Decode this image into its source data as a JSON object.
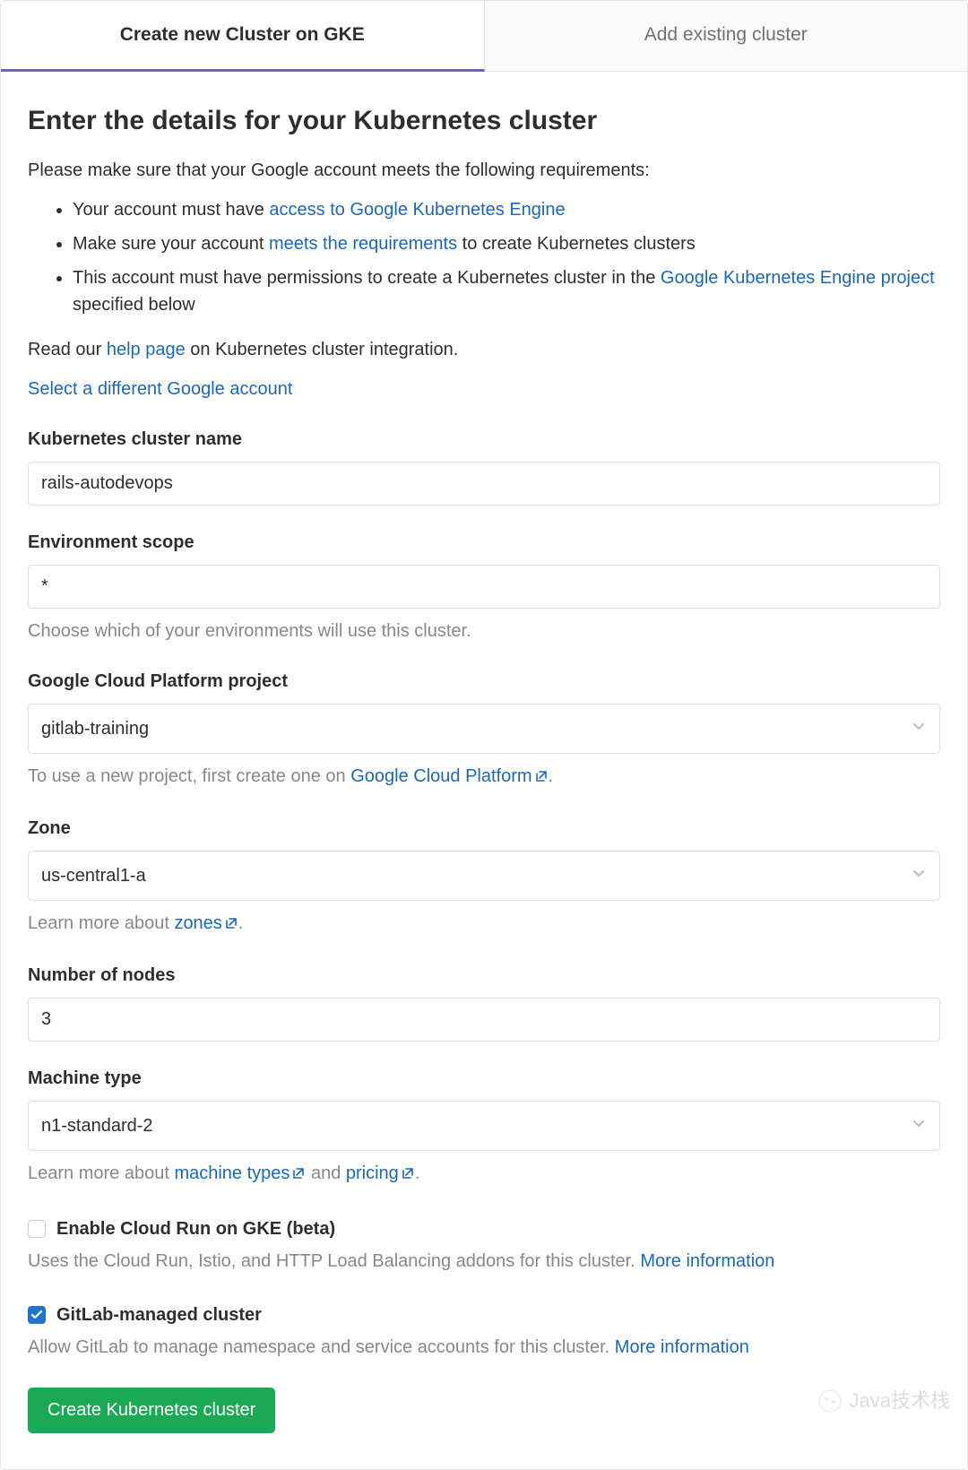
{
  "tabs": {
    "create": "Create new Cluster on GKE",
    "add": "Add existing cluster"
  },
  "heading": "Enter the details for your Kubernetes cluster",
  "intro": "Please make sure that your Google account meets the following requirements:",
  "req1_a": "Your account must have ",
  "req1_link": "access to Google Kubernetes Engine",
  "req2_a": "Make sure your account ",
  "req2_link": "meets the requirements",
  "req2_b": " to create Kubernetes clusters",
  "req3_a": "This account must have permissions to create a Kubernetes cluster in the ",
  "req3_link": "Google Kubernetes Engine project",
  "req3_b": " specified below",
  "readour_a": "Read our ",
  "readour_link": "help page",
  "readour_b": " on Kubernetes cluster integration.",
  "select_account": "Select a different Google account",
  "fields": {
    "name": {
      "label": "Kubernetes cluster name",
      "value": "rails-autodevops"
    },
    "env": {
      "label": "Environment scope",
      "value": "*",
      "help": "Choose which of your environments will use this cluster."
    },
    "project": {
      "label": "Google Cloud Platform project",
      "value": "gitlab-training",
      "help_a": "To use a new project, first create one on ",
      "help_link": "Google Cloud Platform",
      "help_b": "."
    },
    "zone": {
      "label": "Zone",
      "value": "us-central1-a",
      "help_a": "Learn more about ",
      "help_link": "zones",
      "help_b": "."
    },
    "nodes": {
      "label": "Number of nodes",
      "value": "3"
    },
    "machine": {
      "label": "Machine type",
      "value": "n1-standard-2",
      "help_a": "Learn more about ",
      "help_link1": "machine types",
      "help_mid": " and ",
      "help_link2": "pricing",
      "help_b": "."
    }
  },
  "cloudrun": {
    "label": "Enable Cloud Run on GKE (beta)",
    "help": "Uses the Cloud Run, Istio, and HTTP Load Balancing addons for this cluster. ",
    "more": "More information",
    "checked": false
  },
  "managed": {
    "label": "GitLab-managed cluster",
    "help": "Allow GitLab to manage namespace and service accounts for this cluster. ",
    "more": "More information",
    "checked": true
  },
  "submit": "Create Kubernetes cluster",
  "watermark": "Java技术栈"
}
